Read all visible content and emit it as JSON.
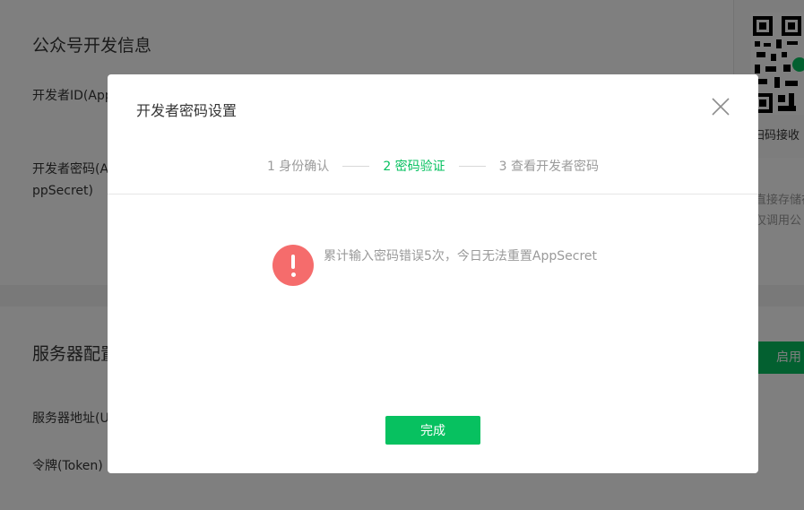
{
  "background": {
    "section1_title": "公众号开发信息",
    "developer_id_label": "开发者ID(App",
    "developer_secret_label": "开发者密码(AppSecret)",
    "qr_caption": "扫码接收",
    "side_note_1": "直接存储在",
    "side_note_2": "仅调用公",
    "section2_title": "服务器配置",
    "server_url_label": "服务器地址(URL)",
    "token_label": "令牌(Token)",
    "enable_button": "启用"
  },
  "dialog": {
    "title": "开发者密码设置",
    "steps": [
      "1 身份确认",
      "2 密码验证",
      "3 查看开发者密码"
    ],
    "active_step": 1,
    "message": "累计输入密码错误5次，今日无法重置AppSecret",
    "done_button": "完成"
  },
  "colors": {
    "accent": "#07c160",
    "warning": "#f56c6c",
    "mask": "rgba(0,0,0,0.5)"
  },
  "icons": {
    "close": "close-icon",
    "warning": "exclamation-circle-icon",
    "qr": "qr-code-icon"
  }
}
